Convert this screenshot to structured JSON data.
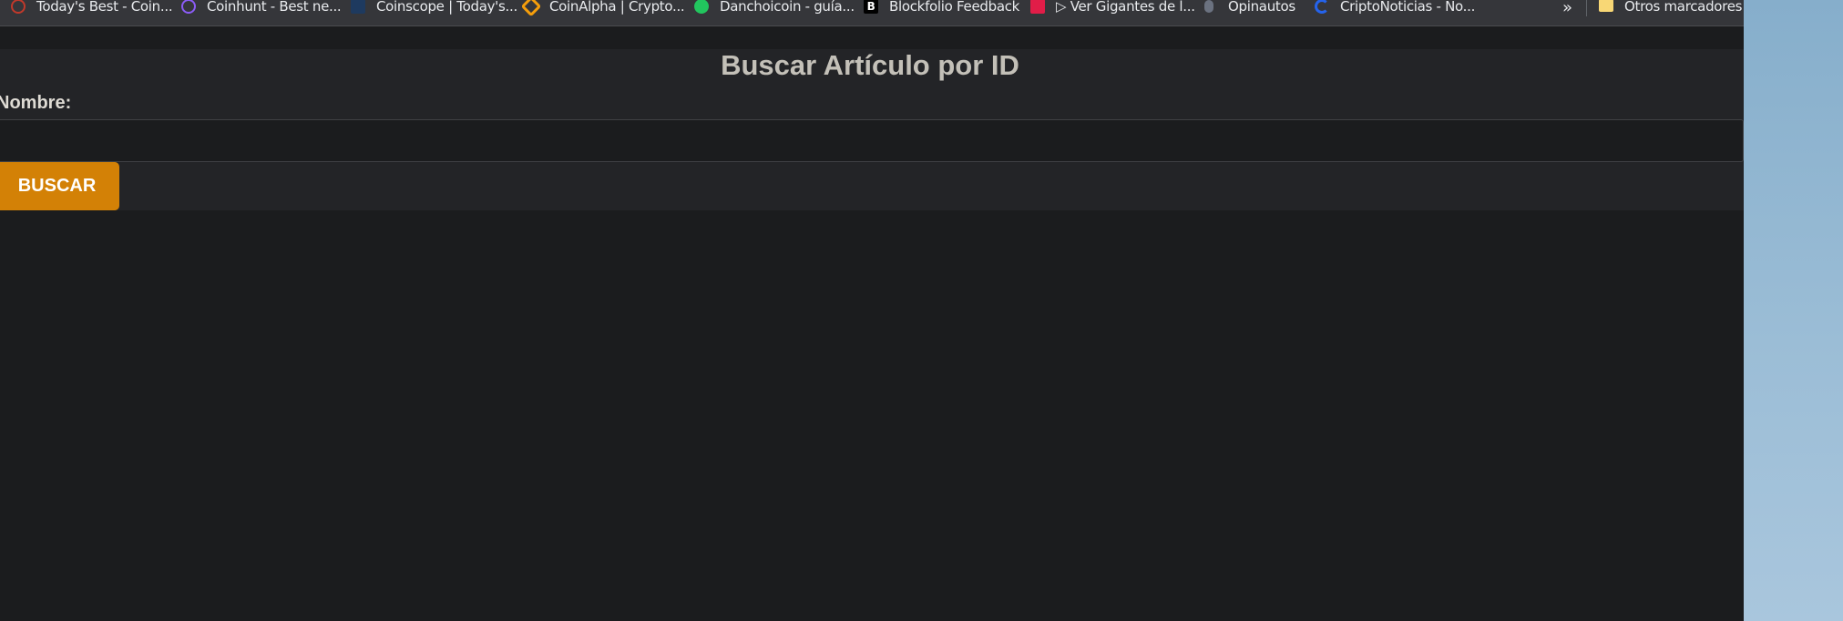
{
  "bookmarks_bar": {
    "items": [
      {
        "label": "Today's Best - Coin...",
        "icon": "red-ring-icon",
        "color": "#c0392b"
      },
      {
        "label": "Coinhunt - Best ne...",
        "icon": "purple-hexagon-icon",
        "color": "#8b5cf6"
      },
      {
        "label": "Coinscope | Today's...",
        "icon": "scope-icon",
        "color": "#3b82f6"
      },
      {
        "label": "CoinAlpha | Crypto...",
        "icon": "orange-arrows-icon",
        "color": "#f59e0b"
      },
      {
        "label": "Danchoicoin - guía...",
        "icon": "green-circle-icon",
        "color": "#22c55e"
      },
      {
        "label": "Blockfolio Feedback",
        "icon": "b-letter-icon",
        "color": "#111111"
      },
      {
        "label": "▷ Ver Gigantes de l...",
        "icon": "red-k-icon",
        "color": "#e11d48"
      },
      {
        "label": "Opinautos",
        "icon": "grey-pin-icon",
        "color": "#6b7280"
      },
      {
        "label": "CriptoNoticias - No...",
        "icon": "blue-c-icon",
        "color": "#2563eb"
      }
    ],
    "overflow_label": "»",
    "other_bookmarks_label": "Otros marcadores",
    "folder_icon": "folder-icon"
  },
  "page": {
    "title": "Buscar Artículo por ID",
    "field_label": "Nombre:",
    "input_value": "",
    "input_placeholder": "",
    "button_label": "BUSCAR"
  },
  "colors": {
    "accent": "#d38106",
    "background": "#1b1c1e",
    "card": "#232427"
  }
}
